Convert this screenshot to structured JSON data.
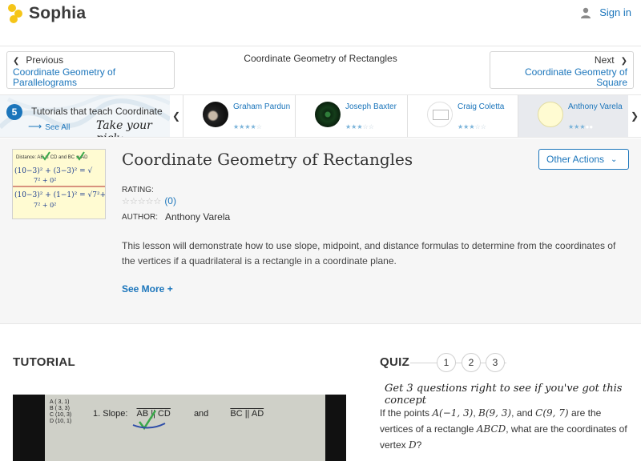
{
  "header": {
    "brand": "Sophia",
    "signin_label": "Sign in"
  },
  "nav": {
    "prev_dir": "Previous",
    "prev_link": "Coordinate Geometry of Parallelograms",
    "next_dir": "Next",
    "next_link": "Coordinate Geometry of Square",
    "current_title": "Coordinate Geometry of Rectangles"
  },
  "tutorials": {
    "count": "5",
    "label": "Tutorials that teach Coordinate",
    "see_all": "See All",
    "pick_text": "Take your pick:",
    "cards": [
      {
        "name": "Graham Pardun",
        "rating": 4
      },
      {
        "name": "Joseph Baxter",
        "rating": 3
      },
      {
        "name": "Craig Coletta",
        "rating": 3
      },
      {
        "name": "Anthony Varela",
        "rating": 3
      }
    ]
  },
  "lesson": {
    "title": "Coordinate Geometry of Rectangles",
    "other_actions": "Other Actions",
    "rating_label": "RATING:",
    "rating_count": "(0)",
    "author_label": "AUTHOR:",
    "author_name": "Anthony Varela",
    "description": "This lesson will demonstrate how to use slope, midpoint, and distance formulas to determine from the coordinates of the vertices if a quadrilateral is a rectangle in a coordinate plane.",
    "see_more": "See More +",
    "thumb_text": {
      "top": "Distance: AB ≅ CD  and  BC ≅ AD",
      "line1": "(10−3)² + (3−3)² = √",
      "line2": "7² + 0²",
      "line3": "(10−3)² + (1−1)² = √7²+",
      "line4": "7² + 0²"
    }
  },
  "tutorial": {
    "heading": "TUTORIAL",
    "video_points": [
      "A ( 3, 1)",
      "B ( 3, 3)",
      "C (10, 3)",
      "D (10, 1)"
    ],
    "video_slope": "1.  Slope:",
    "video_seg1": "AB || CD",
    "video_and": "and",
    "video_seg2": "BC || AD"
  },
  "quiz": {
    "heading": "QUIZ",
    "numbers": [
      "1",
      "2",
      "3"
    ],
    "prompt": "Get 3 questions right to see if you've got this concept",
    "q_part1": "If the points ",
    "pA": "A(−1, 3)",
    "q_comma1": ", ",
    "pB": "B(9, 3)",
    "q_and": ", and ",
    "pC": "C(9, 7)",
    "q_part2": " are the vertices of a rectangle ",
    "rect": "ABCD",
    "q_part3": ", what are the coordinates of vertex ",
    "vD": "D",
    "q_end": "?"
  },
  "colors": {
    "brand_yellow": "#f5c518",
    "link_blue": "#1b75bb"
  }
}
